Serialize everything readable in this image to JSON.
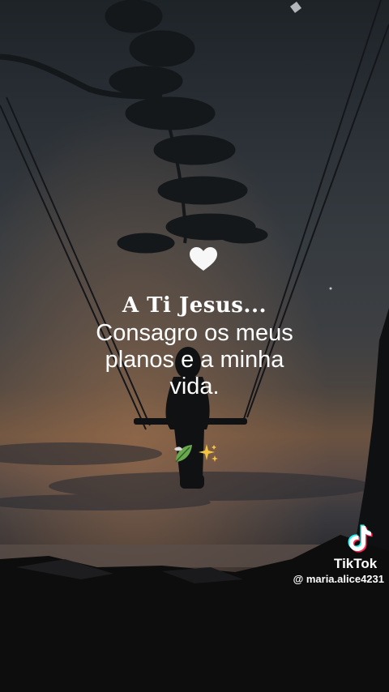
{
  "quote": {
    "title": "A Ti Jesus...",
    "line1": "Consagro os meus",
    "line2": "planos e a minha",
    "line3": "vida."
  },
  "icons": {
    "heart": "white-heart-icon",
    "leaf": "leaf-icon",
    "sparkles": "sparkles-icon"
  },
  "watermark": {
    "brand": "TikTok",
    "username": "@ maria.alice4231"
  },
  "colors": {
    "sky_top": "#1e2328",
    "sunset": "#6a5240",
    "text": "#ffffff"
  }
}
